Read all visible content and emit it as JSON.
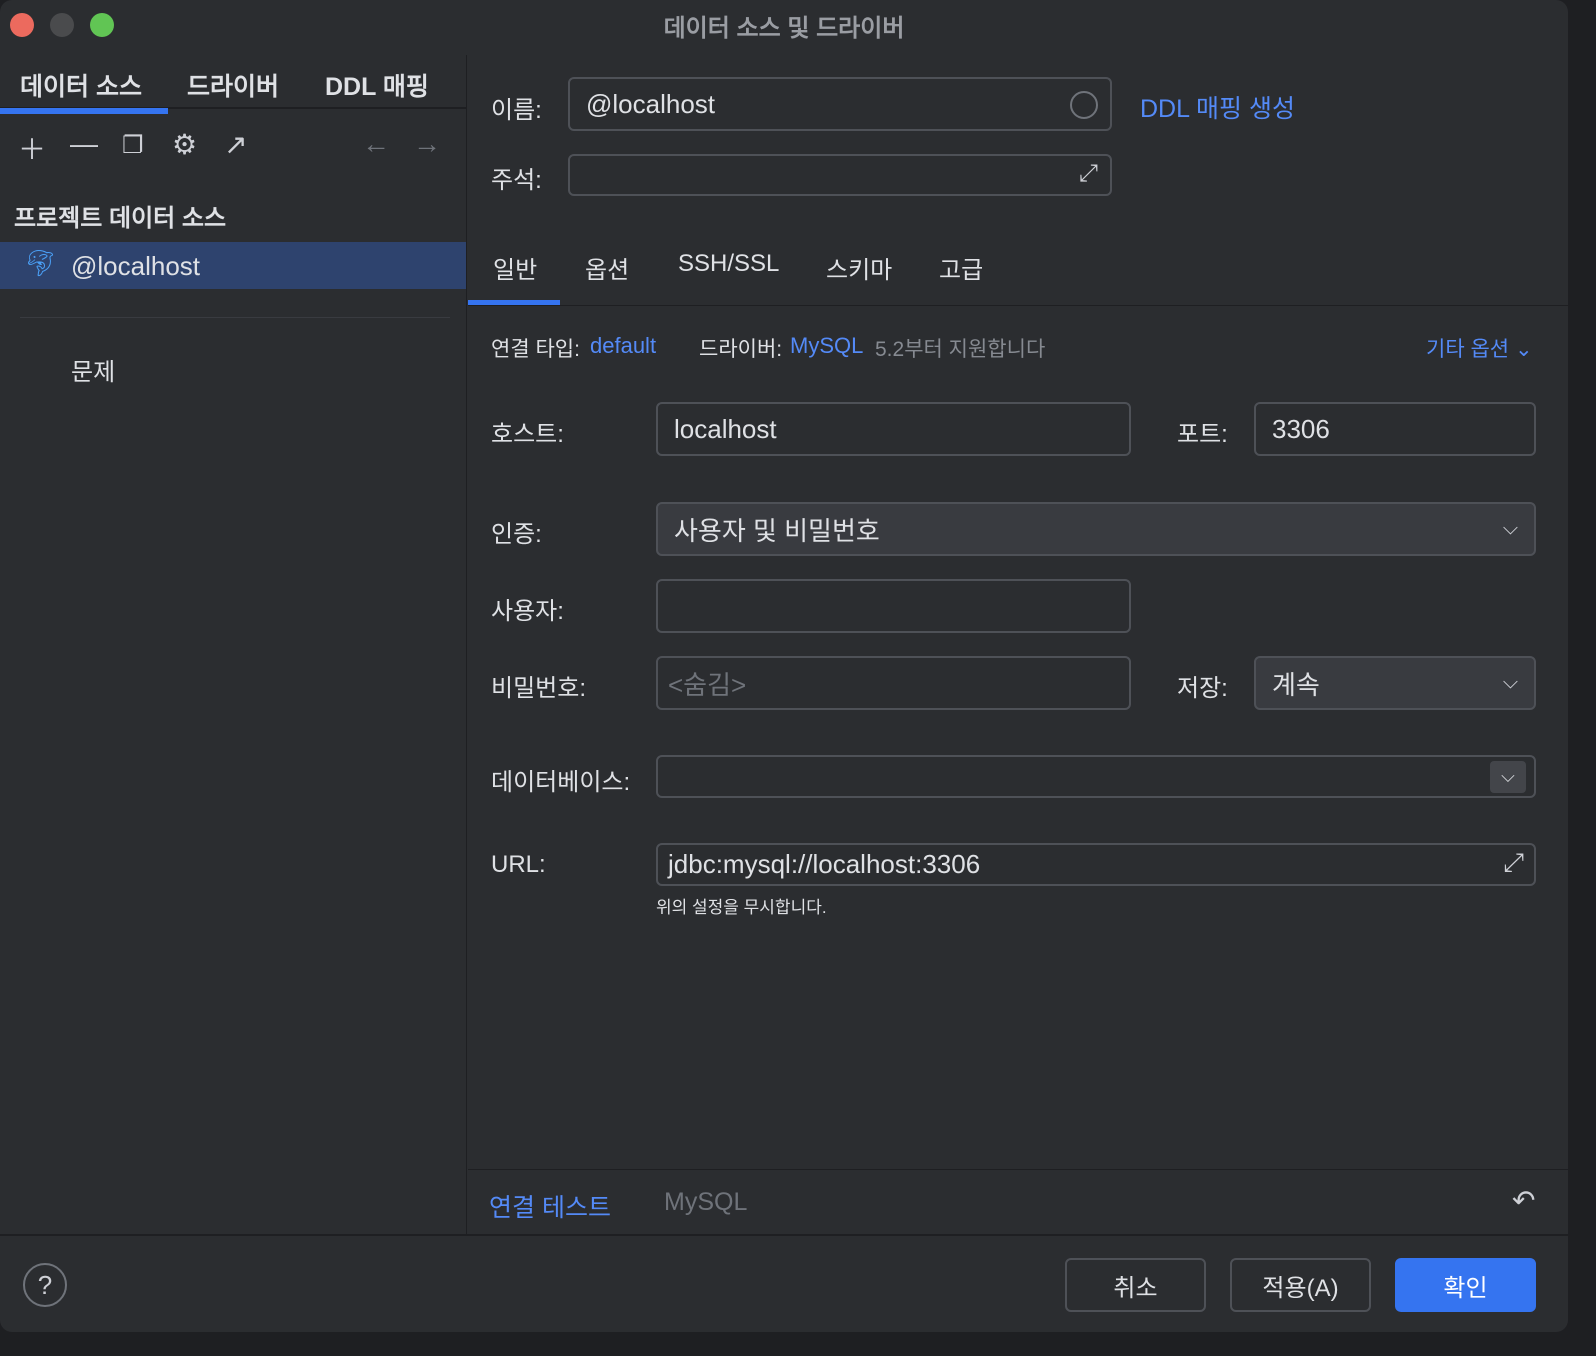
{
  "window": {
    "title": "데이터 소스 및 드라이버"
  },
  "left_tabs": [
    "데이터 소스",
    "드라이버",
    "DDL 매핑"
  ],
  "section_title": "프로젝트 데이터 소스",
  "datasource": "@localhost",
  "problems": "문제",
  "name_label": "이름:",
  "name_value": "@localhost",
  "ddl_link": "DDL 매핑 생성",
  "comment_label": "주석:",
  "tabs": [
    "일반",
    "옵션",
    "SSH/SSL",
    "스키마",
    "고급"
  ],
  "conn_type_label": "연결 타입:",
  "conn_type": "default",
  "driver_label": "드라이버:",
  "driver": "MySQL",
  "driver_note": "5.2부터 지원합니다",
  "more_options": "기타 옵션",
  "host_label": "호스트:",
  "host": "localhost",
  "port_label": "포트:",
  "port": "3306",
  "auth_label": "인증:",
  "auth": "사용자 및 비밀번호",
  "user_label": "사용자:",
  "user": "",
  "password_label": "비밀번호:",
  "password_placeholder": "<숨김>",
  "save_label": "저장:",
  "save": "계속",
  "database_label": "데이터베이스:",
  "database": "",
  "url_label": "URL:",
  "url": "jdbc:mysql://localhost:3306",
  "url_note": "위의 설정을 무시합니다.",
  "test_connection": "연결 테스트",
  "bottom_driver": "MySQL",
  "buttons": {
    "cancel": "취소",
    "apply": "적용(A)",
    "ok": "확인"
  }
}
